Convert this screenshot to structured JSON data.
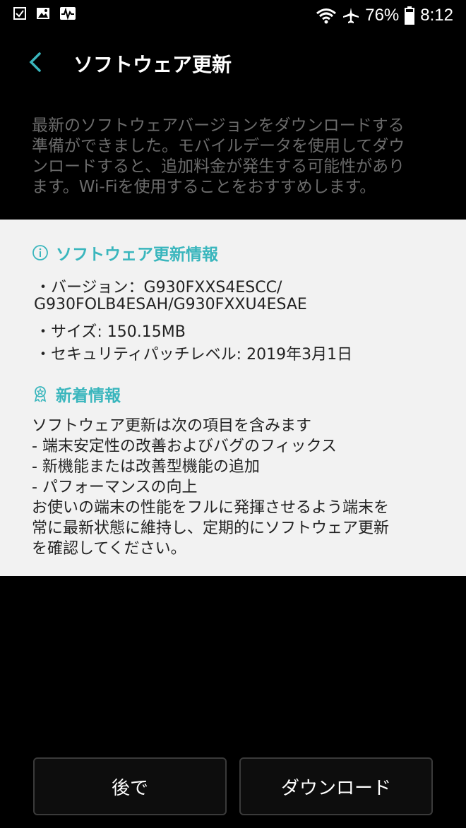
{
  "status_bar": {
    "battery_percent": "76%",
    "time": "8:12",
    "icons": [
      "task-icon",
      "image-icon",
      "activity-icon",
      "wifi-icon",
      "airplane-icon",
      "battery-icon"
    ]
  },
  "header": {
    "title": "ソフトウェア更新"
  },
  "description": [
    "最新のソフトウェアバージョンをダウンロードする",
    "準備ができました。モバイルデータを使用してダウ",
    "ンロードすると、追加料金が発生する可能性があり",
    "ます。Wi-Fiを使用することをおすすめします。"
  ],
  "info_section": {
    "heading": "ソフトウェア更新情報",
    "version_line1": "・バージョン：G930FXXS4ESCC/",
    "version_line2": "G930FOLB4ESAH/G930FXXU4ESAE",
    "size": "・サイズ: 150.15MB",
    "security": "・セキュリティパッチレベル: 2019年3月1日"
  },
  "whats_new": {
    "heading": "新着情報",
    "lines": [
      "ソフトウェア更新は次の項目を含みます",
      " - 端末安定性の改善およびバグのフィックス",
      " - 新機能または改善型機能の追加",
      " - パフォーマンスの向上",
      "お使いの端末の性能をフルに発揮させるよう端末を",
      "常に最新状態に維持し、定期的にソフトウェア更新",
      "を確認してください。"
    ]
  },
  "buttons": {
    "later": "後で",
    "download": "ダウンロード"
  },
  "colors": {
    "accent": "#3ab6bd",
    "background": "#000000",
    "panel": "#f2f2f2",
    "description_text": "#6b6b6b"
  }
}
